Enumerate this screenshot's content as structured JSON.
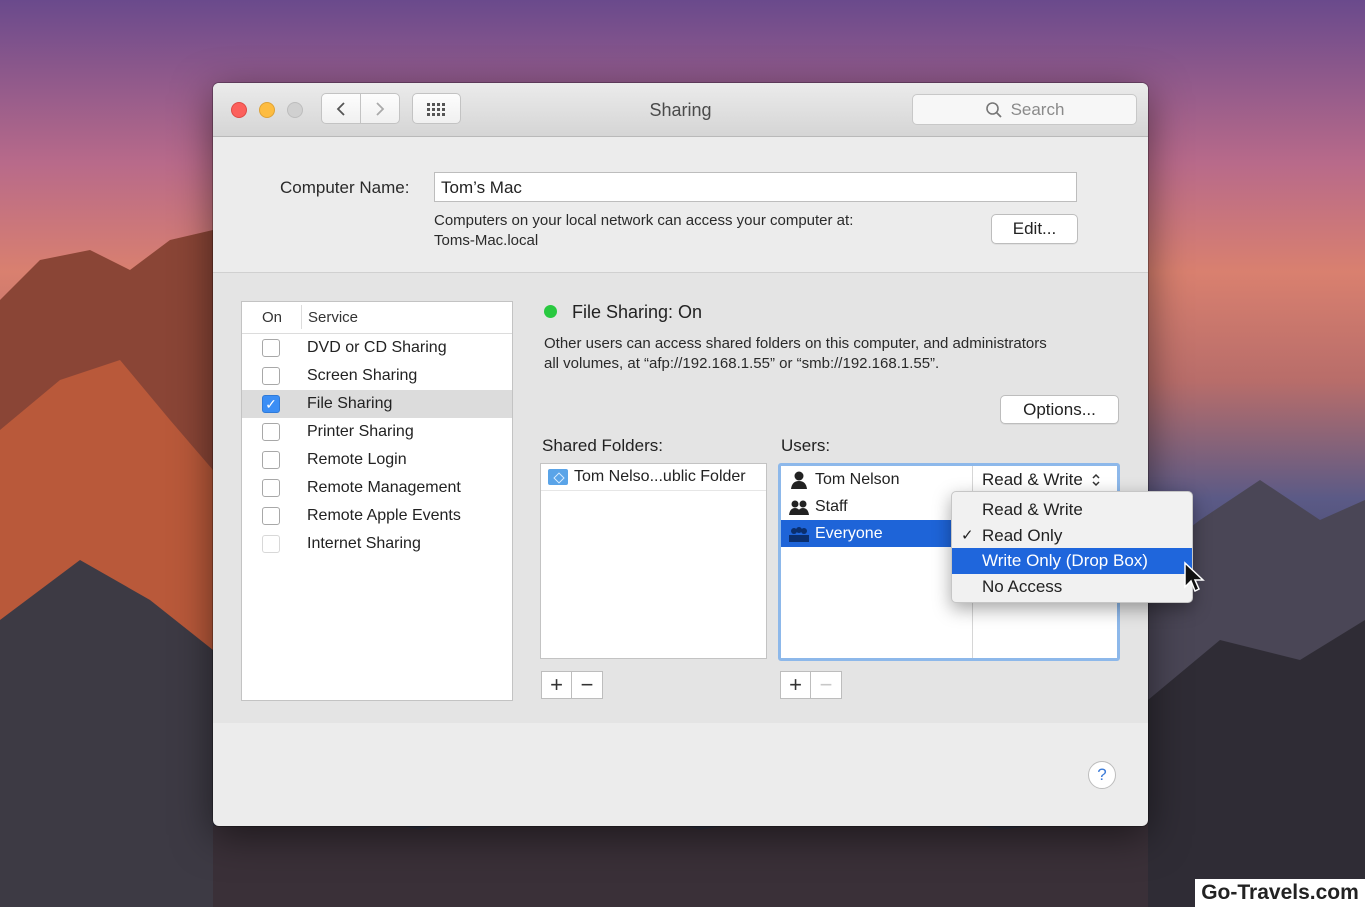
{
  "window": {
    "title": "Sharing",
    "search_placeholder": "Search",
    "traffic_lights": [
      "close",
      "minimize",
      "zoom"
    ],
    "nav_icons": [
      "chevron-left-icon",
      "chevron-right-icon",
      "grid-icon"
    ]
  },
  "computer_name": {
    "label": "Computer Name:",
    "value": "Tom’s Mac",
    "note_line1": "Computers on your local network can access your computer at:",
    "note_line2": "Toms-Mac.local",
    "edit_button": "Edit..."
  },
  "services": {
    "header_on": "On",
    "header_service": "Service",
    "items": [
      {
        "label": "DVD or CD Sharing",
        "checked": false,
        "selected": false
      },
      {
        "label": "Screen Sharing",
        "checked": false,
        "selected": false
      },
      {
        "label": "File Sharing",
        "checked": true,
        "selected": true
      },
      {
        "label": "Printer Sharing",
        "checked": false,
        "selected": false
      },
      {
        "label": "Remote Login",
        "checked": false,
        "selected": false
      },
      {
        "label": "Remote Management",
        "checked": false,
        "selected": false
      },
      {
        "label": "Remote Apple Events",
        "checked": false,
        "selected": false
      },
      {
        "label": "Internet Sharing",
        "checked": false,
        "selected": false
      }
    ]
  },
  "file_sharing": {
    "status": "File Sharing: On",
    "status_color": "#29c940",
    "description_line1": "Other users can access shared folders on this computer, and administrators",
    "description_line2": "all volumes, at “afp://192.168.1.55” or “smb://192.168.1.55”.",
    "options_button": "Options...",
    "shared_folders_label": "Shared Folders:",
    "users_label": "Users:",
    "folders": [
      "Tom Nelso...ublic Folder"
    ],
    "users": [
      {
        "name": "Tom Nelson",
        "icon": "user-icon",
        "permission": "Read & Write",
        "selected": false
      },
      {
        "name": "Staff",
        "icon": "group-icon",
        "permission": "",
        "selected": false
      },
      {
        "name": "Everyone",
        "icon": "everyone-icon",
        "permission": "",
        "selected": true
      }
    ],
    "add_symbol": "+",
    "remove_symbol": "−"
  },
  "permission_menu": {
    "items": [
      {
        "label": "Read & Write",
        "checked": false,
        "highlighted": false
      },
      {
        "label": "Read Only",
        "checked": true,
        "highlighted": false
      },
      {
        "label": "Write Only (Drop Box)",
        "checked": false,
        "highlighted": true
      },
      {
        "label": "No Access",
        "checked": false,
        "highlighted": false
      }
    ],
    "highlight_color": "#1f66dc"
  },
  "help_symbol": "?",
  "watermark": "Go-Travels.com"
}
